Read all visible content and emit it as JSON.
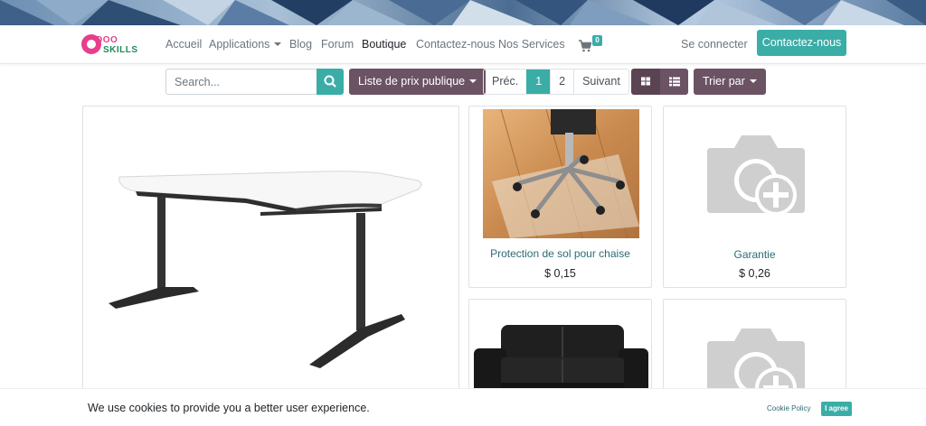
{
  "nav": {
    "logo_top": "DOO",
    "logo_bottom": "SKILLS",
    "items": [
      {
        "label": "Accueil"
      },
      {
        "label": "Applications"
      },
      {
        "label": "Blog"
      },
      {
        "label": "Forum"
      },
      {
        "label": "Boutique"
      },
      {
        "label": "Contactez-nous"
      },
      {
        "label": "Nos Services"
      }
    ],
    "cart_count": "0",
    "login": "Se connecter",
    "contact_button": "Contactez-nous"
  },
  "toolbar": {
    "search_placeholder": "Search...",
    "pricelist": "Liste de prix publique",
    "pager": {
      "prev": "Préc.",
      "pages": [
        "1",
        "2"
      ],
      "next": "Suivant",
      "current": "1"
    },
    "sort": "Trier par"
  },
  "products": [
    {
      "name": "Protection de sol pour chaise",
      "price": "$ 0,15"
    },
    {
      "name": "Garantie",
      "price": "$ 0,26"
    }
  ],
  "cookie": {
    "text": "We use cookies to provide you a better user experience.",
    "policy": "Cookie Policy",
    "agree": "I agree"
  },
  "colors": {
    "primary": "#3aada7",
    "secondary": "#6b5364",
    "link": "#2d6b71"
  }
}
